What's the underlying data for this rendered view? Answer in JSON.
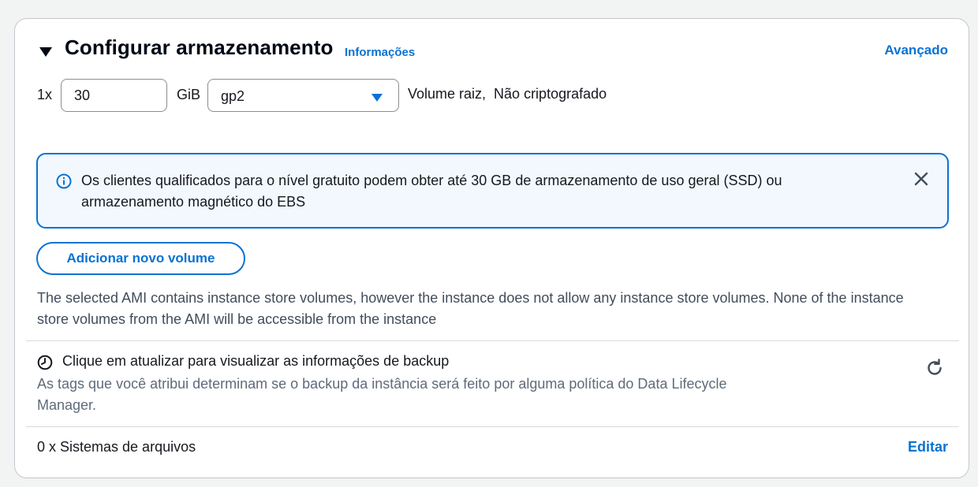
{
  "section": {
    "title": "Configurar armazenamento",
    "info_link": "Informações",
    "advanced_link": "Avançado"
  },
  "volume": {
    "count_label": "1x",
    "size_value": "30",
    "unit_label": "GiB",
    "volume_type": "gp2",
    "description": "Volume raiz,  Não criptografado"
  },
  "alert": {
    "message": "Os clientes qualificados para o nível gratuito podem obter até 30 GB de armazenamento de uso geral (SSD) ou armazenamento magnético do EBS"
  },
  "add_volume_button": "Adicionar novo volume",
  "instance_store_note": "The selected AMI contains instance store volumes, however the instance does not allow any instance store volumes. None of the instance store volumes from the AMI will be accessible from the instance",
  "backup": {
    "title": "Clique em atualizar para visualizar as informações de backup",
    "description": "As tags que você atribui determinam se o backup da instância será feito por alguma política do Data Lifecycle Manager."
  },
  "file_systems": {
    "count_label": "0 x Sistemas de arquivos",
    "edit_link": "Editar"
  },
  "colors": {
    "accent": "#0972d3",
    "alert_background": "#f2f8fd",
    "muted_text": "#5f6b7a"
  },
  "icons": [
    "caret-down-icon",
    "dropdown-caret-icon",
    "info-icon",
    "close-icon",
    "clock-icon",
    "refresh-icon"
  ]
}
